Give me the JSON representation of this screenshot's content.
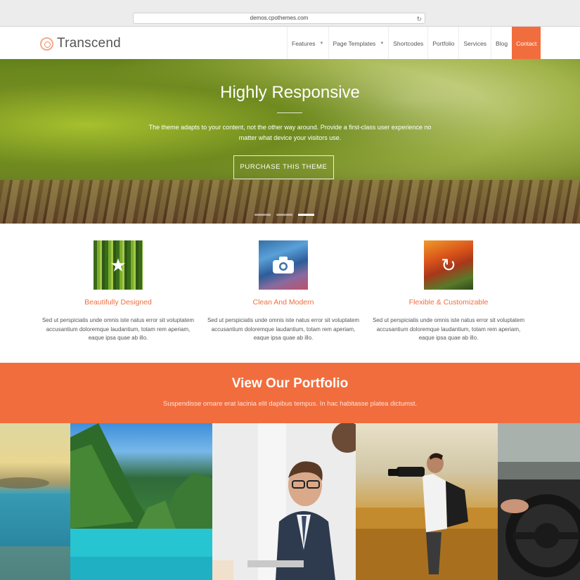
{
  "browser": {
    "url": "demos.cpothemes.com"
  },
  "site": {
    "logo": "Transcend"
  },
  "nav": [
    {
      "label": "Features",
      "dropdown": true
    },
    {
      "label": "Page Templates",
      "dropdown": true
    },
    {
      "label": "Shortcodes"
    },
    {
      "label": "Portfolio"
    },
    {
      "label": "Services"
    },
    {
      "label": "Blog"
    },
    {
      "label": "Contact",
      "active": true
    }
  ],
  "hero": {
    "title": "Highly Responsive",
    "text": "The theme adapts to your content, not the other way around. Provide a first-class user experience no matter what device your visitors use.",
    "button": "PURCHASE THIS THEME",
    "slides": 3,
    "active_slide": 3
  },
  "features": [
    {
      "title": "Beautifully Designed",
      "icon": "star-icon",
      "desc": "Sed ut perspiciatis unde omnis iste natus error sit voluptatem accusantium doloremque laudantium, totam rem aperiam, eaque ipsa quae ab illo."
    },
    {
      "title": "Clean And Modern",
      "icon": "camera-icon",
      "desc": "Sed ut perspiciatis unde omnis iste natus error sit voluptatem accusantium doloremque laudantium, totam rem aperiam, eaque ipsa quae ab illo."
    },
    {
      "title": "Flexible & Customizable",
      "icon": "refresh-icon",
      "desc": "Sed ut perspiciatis unde omnis iste natus error sit voluptatem accusantium doloremque laudantium, totam rem aperiam, eaque ipsa quae ab illo."
    }
  ],
  "portfolio": {
    "title": "View Our Portfolio",
    "subtitle": "Suspendisse ornare erat lacinia elit dapibus tempus. In hac habitasse platea dictumst."
  },
  "colors": {
    "accent": "#f26d3d"
  }
}
